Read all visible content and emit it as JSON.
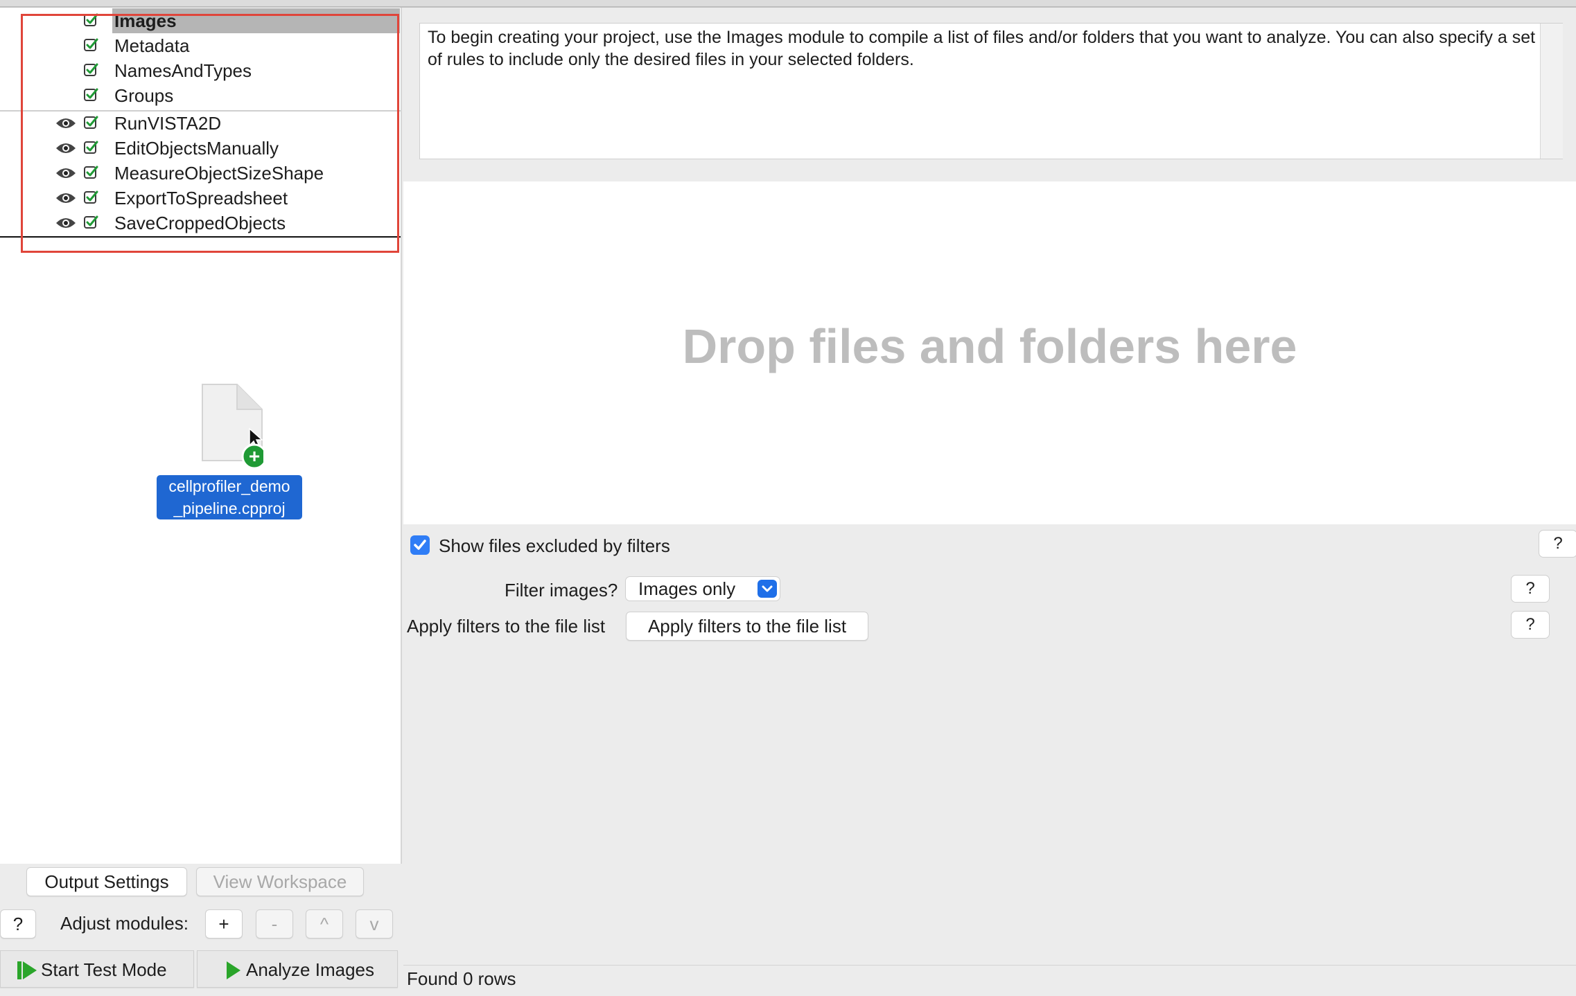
{
  "pipeline": {
    "modules": [
      {
        "name": "Images",
        "eye": false
      },
      {
        "name": "Metadata",
        "eye": false
      },
      {
        "name": "NamesAndTypes",
        "eye": false
      },
      {
        "name": "Groups",
        "eye": false
      },
      {
        "name": "RunVISTA2D",
        "eye": true
      },
      {
        "name": "EditObjectsManually",
        "eye": true
      },
      {
        "name": "MeasureObjectSizeShape",
        "eye": true
      },
      {
        "name": "ExportToSpreadsheet",
        "eye": true
      },
      {
        "name": "SaveCroppedObjects",
        "eye": true
      }
    ],
    "selected": "Images",
    "highlight_color": "#e0453a"
  },
  "drag": {
    "file_label": "cellprofiler_demo\n_pipeline.cpproj"
  },
  "left_controls": {
    "output_settings": "Output Settings",
    "view_workspace": "View Workspace",
    "help": "?",
    "adjust_label": "Adjust modules:",
    "add": "+",
    "remove": "-",
    "up": "^",
    "down": "v",
    "start_test": "Start Test Mode",
    "analyze": "Analyze Images"
  },
  "help_text": "To begin creating your project, use the Images module to compile a list of files and/or folders that you want to analyze. You can also specify a set of rules to include only the desired files in your selected folders.",
  "drop_zone": {
    "text": "Drop files and folders here"
  },
  "settings": {
    "show_excluded": "Show files excluded by filters",
    "show_excluded_checked": true,
    "filter_label": "Filter images?",
    "filter_value": "Images only",
    "apply_label": "Apply filters to the file list",
    "apply_button": "Apply filters to the file list",
    "help": "?"
  },
  "status": {
    "text": "Found 0 rows"
  },
  "colors": {
    "accent": "#2f7df6",
    "play": "#2aa52a"
  }
}
